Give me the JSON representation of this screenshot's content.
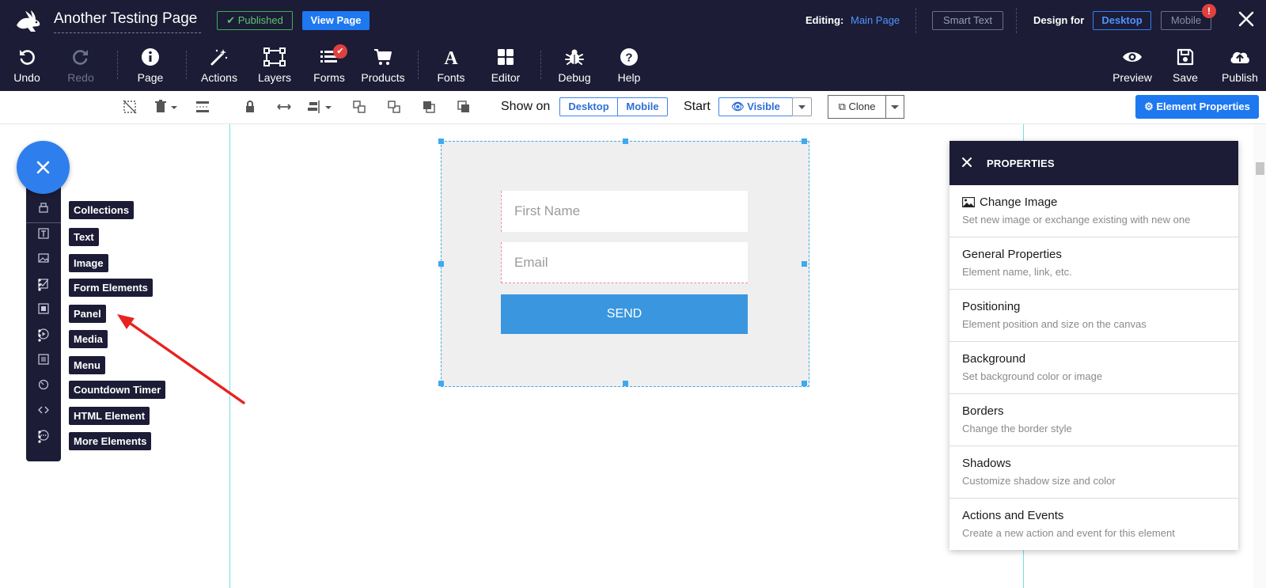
{
  "header": {
    "page_title": "Another Testing Page",
    "published": "Published",
    "view_page": "View Page",
    "editing_label": "Editing:",
    "editing_value": "Main Page",
    "smart_text": "Smart Text",
    "design_for": "Design for",
    "desktop": "Desktop",
    "mobile": "Mobile",
    "alert_badge": "!",
    "accent_color": "#1e78f0"
  },
  "toolbar": {
    "undo": "Undo",
    "redo": "Redo",
    "page": "Page",
    "actions": "Actions",
    "layers": "Layers",
    "forms": "Forms",
    "products": "Products",
    "fonts": "Fonts",
    "editor": "Editor",
    "debug": "Debug",
    "help": "Help",
    "preview": "Preview",
    "save": "Save",
    "publish": "Publish"
  },
  "subbar": {
    "show_on": "Show on",
    "desktop": "Desktop",
    "mobile": "Mobile",
    "start": "Start",
    "visible": "Visible",
    "clone": "Clone",
    "element_properties": "Element Properties"
  },
  "form": {
    "first_name_placeholder": "First Name",
    "email_placeholder": "Email",
    "send": "SEND"
  },
  "element_menu": {
    "items": [
      {
        "label": "Collections",
        "icon": "collections-icon"
      },
      {
        "label": "Text",
        "icon": "text-icon"
      },
      {
        "label": "Image",
        "icon": "image-icon"
      },
      {
        "label": "Form Elements",
        "icon": "form-elements-icon"
      },
      {
        "label": "Panel",
        "icon": "panel-icon"
      },
      {
        "label": "Media",
        "icon": "media-icon"
      },
      {
        "label": "Menu",
        "icon": "menu-icon"
      },
      {
        "label": "Countdown Timer",
        "icon": "timer-icon"
      },
      {
        "label": "HTML Element",
        "icon": "code-icon"
      },
      {
        "label": "More Elements",
        "icon": "more-icon"
      }
    ]
  },
  "properties": {
    "title": "PROPERTIES",
    "items": [
      {
        "title": "Change Image",
        "desc": "Set new image or exchange existing with new one"
      },
      {
        "title": "General Properties",
        "desc": "Element name, link, etc."
      },
      {
        "title": "Positioning",
        "desc": "Element position and size on the canvas"
      },
      {
        "title": "Background",
        "desc": "Set background color or image"
      },
      {
        "title": "Borders",
        "desc": "Change the border style"
      },
      {
        "title": "Shadows",
        "desc": "Customize shadow size and color"
      },
      {
        "title": "Actions and Events",
        "desc": "Create a new action and event for this element"
      }
    ]
  }
}
